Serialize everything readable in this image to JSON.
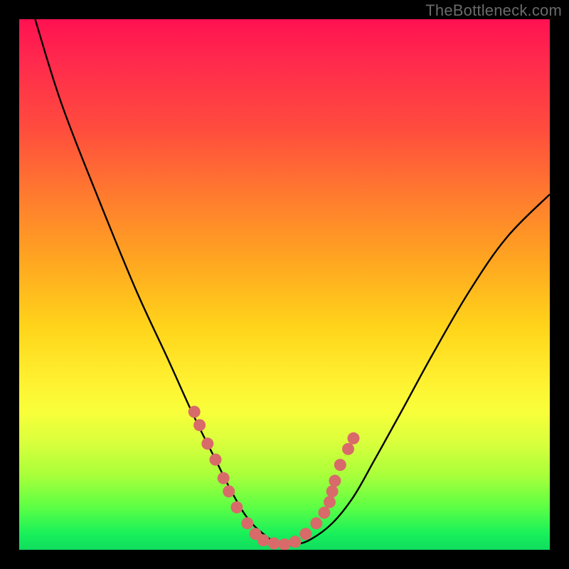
{
  "watermark": "TheBottleneck.com",
  "chart_data": {
    "type": "line",
    "title": "",
    "xlabel": "",
    "ylabel": "",
    "xlim": [
      0,
      100
    ],
    "ylim": [
      0,
      100
    ],
    "series": [
      {
        "name": "curve",
        "x": [
          3,
          8,
          15,
          22,
          28,
          33,
          37,
          40,
          43,
          46,
          49,
          52,
          55,
          59,
          63,
          67,
          72,
          78,
          85,
          92,
          100
        ],
        "y": [
          100,
          84,
          66,
          49,
          36,
          25,
          17,
          11,
          6,
          3,
          1,
          1,
          2,
          5,
          10,
          17,
          26,
          37,
          49,
          59,
          67
        ]
      }
    ],
    "markers": {
      "name": "dots",
      "color": "#d86a6a",
      "points": [
        {
          "x": 33.0,
          "y": 26.0
        },
        {
          "x": 34.0,
          "y": 23.5
        },
        {
          "x": 35.5,
          "y": 20.0
        },
        {
          "x": 37.0,
          "y": 17.0
        },
        {
          "x": 38.5,
          "y": 13.5
        },
        {
          "x": 39.5,
          "y": 11.0
        },
        {
          "x": 41.0,
          "y": 8.0
        },
        {
          "x": 43.0,
          "y": 5.0
        },
        {
          "x": 44.5,
          "y": 3.0
        },
        {
          "x": 46.0,
          "y": 1.8
        },
        {
          "x": 48.0,
          "y": 1.2
        },
        {
          "x": 50.0,
          "y": 1.0
        },
        {
          "x": 52.0,
          "y": 1.5
        },
        {
          "x": 54.0,
          "y": 3.0
        },
        {
          "x": 56.0,
          "y": 5.0
        },
        {
          "x": 57.5,
          "y": 7.0
        },
        {
          "x": 58.5,
          "y": 9.0
        },
        {
          "x": 59.0,
          "y": 11.0
        },
        {
          "x": 59.5,
          "y": 13.0
        },
        {
          "x": 60.5,
          "y": 16.0
        },
        {
          "x": 62.0,
          "y": 19.0
        },
        {
          "x": 63.0,
          "y": 21.0
        }
      ]
    }
  }
}
